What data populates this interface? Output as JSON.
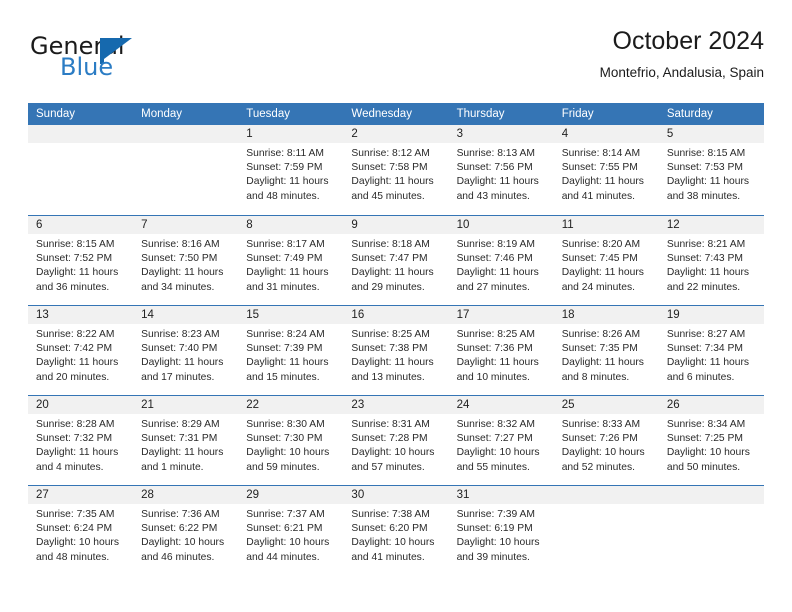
{
  "brand": {
    "word_one": "General",
    "word_two": "Blue",
    "flag_icon": "brand-flag-icon",
    "accent_color": "#1669ae",
    "blue_text_color": "#2b7cc4"
  },
  "header": {
    "title": "October 2024",
    "subtitle": "Montefrio, Andalusia, Spain"
  },
  "calendar": {
    "header_bg": "#3575b5",
    "header_text_color": "#ffffff",
    "day_number_bg": "#f1f1f1",
    "weekdays": [
      "Sunday",
      "Monday",
      "Tuesday",
      "Wednesday",
      "Thursday",
      "Friday",
      "Saturday"
    ],
    "weeks": [
      [
        {
          "day": "",
          "sunrise": "",
          "sunset": "",
          "daylight": ""
        },
        {
          "day": "",
          "sunrise": "",
          "sunset": "",
          "daylight": ""
        },
        {
          "day": "1",
          "sunrise": "Sunrise: 8:11 AM",
          "sunset": "Sunset: 7:59 PM",
          "daylight": "Daylight: 11 hours and 48 minutes."
        },
        {
          "day": "2",
          "sunrise": "Sunrise: 8:12 AM",
          "sunset": "Sunset: 7:58 PM",
          "daylight": "Daylight: 11 hours and 45 minutes."
        },
        {
          "day": "3",
          "sunrise": "Sunrise: 8:13 AM",
          "sunset": "Sunset: 7:56 PM",
          "daylight": "Daylight: 11 hours and 43 minutes."
        },
        {
          "day": "4",
          "sunrise": "Sunrise: 8:14 AM",
          "sunset": "Sunset: 7:55 PM",
          "daylight": "Daylight: 11 hours and 41 minutes."
        },
        {
          "day": "5",
          "sunrise": "Sunrise: 8:15 AM",
          "sunset": "Sunset: 7:53 PM",
          "daylight": "Daylight: 11 hours and 38 minutes."
        }
      ],
      [
        {
          "day": "6",
          "sunrise": "Sunrise: 8:15 AM",
          "sunset": "Sunset: 7:52 PM",
          "daylight": "Daylight: 11 hours and 36 minutes."
        },
        {
          "day": "7",
          "sunrise": "Sunrise: 8:16 AM",
          "sunset": "Sunset: 7:50 PM",
          "daylight": "Daylight: 11 hours and 34 minutes."
        },
        {
          "day": "8",
          "sunrise": "Sunrise: 8:17 AM",
          "sunset": "Sunset: 7:49 PM",
          "daylight": "Daylight: 11 hours and 31 minutes."
        },
        {
          "day": "9",
          "sunrise": "Sunrise: 8:18 AM",
          "sunset": "Sunset: 7:47 PM",
          "daylight": "Daylight: 11 hours and 29 minutes."
        },
        {
          "day": "10",
          "sunrise": "Sunrise: 8:19 AM",
          "sunset": "Sunset: 7:46 PM",
          "daylight": "Daylight: 11 hours and 27 minutes."
        },
        {
          "day": "11",
          "sunrise": "Sunrise: 8:20 AM",
          "sunset": "Sunset: 7:45 PM",
          "daylight": "Daylight: 11 hours and 24 minutes."
        },
        {
          "day": "12",
          "sunrise": "Sunrise: 8:21 AM",
          "sunset": "Sunset: 7:43 PM",
          "daylight": "Daylight: 11 hours and 22 minutes."
        }
      ],
      [
        {
          "day": "13",
          "sunrise": "Sunrise: 8:22 AM",
          "sunset": "Sunset: 7:42 PM",
          "daylight": "Daylight: 11 hours and 20 minutes."
        },
        {
          "day": "14",
          "sunrise": "Sunrise: 8:23 AM",
          "sunset": "Sunset: 7:40 PM",
          "daylight": "Daylight: 11 hours and 17 minutes."
        },
        {
          "day": "15",
          "sunrise": "Sunrise: 8:24 AM",
          "sunset": "Sunset: 7:39 PM",
          "daylight": "Daylight: 11 hours and 15 minutes."
        },
        {
          "day": "16",
          "sunrise": "Sunrise: 8:25 AM",
          "sunset": "Sunset: 7:38 PM",
          "daylight": "Daylight: 11 hours and 13 minutes."
        },
        {
          "day": "17",
          "sunrise": "Sunrise: 8:25 AM",
          "sunset": "Sunset: 7:36 PM",
          "daylight": "Daylight: 11 hours and 10 minutes."
        },
        {
          "day": "18",
          "sunrise": "Sunrise: 8:26 AM",
          "sunset": "Sunset: 7:35 PM",
          "daylight": "Daylight: 11 hours and 8 minutes."
        },
        {
          "day": "19",
          "sunrise": "Sunrise: 8:27 AM",
          "sunset": "Sunset: 7:34 PM",
          "daylight": "Daylight: 11 hours and 6 minutes."
        }
      ],
      [
        {
          "day": "20",
          "sunrise": "Sunrise: 8:28 AM",
          "sunset": "Sunset: 7:32 PM",
          "daylight": "Daylight: 11 hours and 4 minutes."
        },
        {
          "day": "21",
          "sunrise": "Sunrise: 8:29 AM",
          "sunset": "Sunset: 7:31 PM",
          "daylight": "Daylight: 11 hours and 1 minute."
        },
        {
          "day": "22",
          "sunrise": "Sunrise: 8:30 AM",
          "sunset": "Sunset: 7:30 PM",
          "daylight": "Daylight: 10 hours and 59 minutes."
        },
        {
          "day": "23",
          "sunrise": "Sunrise: 8:31 AM",
          "sunset": "Sunset: 7:28 PM",
          "daylight": "Daylight: 10 hours and 57 minutes."
        },
        {
          "day": "24",
          "sunrise": "Sunrise: 8:32 AM",
          "sunset": "Sunset: 7:27 PM",
          "daylight": "Daylight: 10 hours and 55 minutes."
        },
        {
          "day": "25",
          "sunrise": "Sunrise: 8:33 AM",
          "sunset": "Sunset: 7:26 PM",
          "daylight": "Daylight: 10 hours and 52 minutes."
        },
        {
          "day": "26",
          "sunrise": "Sunrise: 8:34 AM",
          "sunset": "Sunset: 7:25 PM",
          "daylight": "Daylight: 10 hours and 50 minutes."
        }
      ],
      [
        {
          "day": "27",
          "sunrise": "Sunrise: 7:35 AM",
          "sunset": "Sunset: 6:24 PM",
          "daylight": "Daylight: 10 hours and 48 minutes."
        },
        {
          "day": "28",
          "sunrise": "Sunrise: 7:36 AM",
          "sunset": "Sunset: 6:22 PM",
          "daylight": "Daylight: 10 hours and 46 minutes."
        },
        {
          "day": "29",
          "sunrise": "Sunrise: 7:37 AM",
          "sunset": "Sunset: 6:21 PM",
          "daylight": "Daylight: 10 hours and 44 minutes."
        },
        {
          "day": "30",
          "sunrise": "Sunrise: 7:38 AM",
          "sunset": "Sunset: 6:20 PM",
          "daylight": "Daylight: 10 hours and 41 minutes."
        },
        {
          "day": "31",
          "sunrise": "Sunrise: 7:39 AM",
          "sunset": "Sunset: 6:19 PM",
          "daylight": "Daylight: 10 hours and 39 minutes."
        },
        {
          "day": "",
          "sunrise": "",
          "sunset": "",
          "daylight": ""
        },
        {
          "day": "",
          "sunrise": "",
          "sunset": "",
          "daylight": ""
        }
      ]
    ]
  }
}
